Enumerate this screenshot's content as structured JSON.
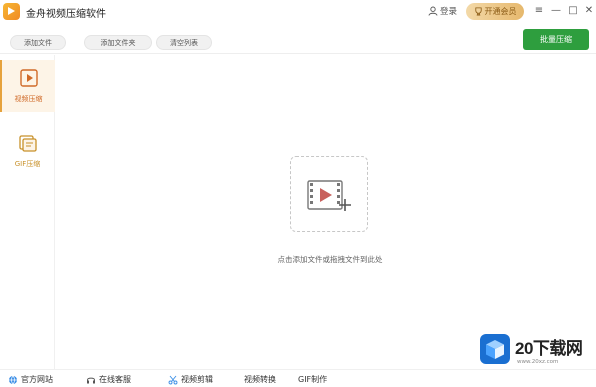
{
  "app": {
    "title": "金舟视频压缩软件"
  },
  "titlebar": {
    "login_label": "登录",
    "vip_label": "开通会员"
  },
  "toolbar": {
    "add_file_label": "添加文件",
    "add_folder_label": "添加文件夹",
    "clear_list_label": "清空列表",
    "batch_compress_label": "批量压缩"
  },
  "sidebar": {
    "items": [
      {
        "label": "视频压缩",
        "icon": "video-play-icon",
        "active": true
      },
      {
        "label": "GIF压缩",
        "icon": "gif-icon",
        "active": false
      }
    ]
  },
  "main": {
    "drop_hint": "点击添加文件或拖拽文件到此处"
  },
  "watermark": {
    "brand": "20下载网",
    "url": "www.20xz.com"
  },
  "footer": {
    "items": [
      {
        "label": "官方网站",
        "icon": "globe-icon"
      },
      {
        "label": "在线客服",
        "icon": "headset-icon"
      },
      {
        "label": "视频剪辑",
        "icon": "scissors-icon"
      },
      {
        "label": "视频转换",
        "icon": "convert-icon"
      },
      {
        "label": "GIF制作",
        "icon": "gif-icon"
      }
    ]
  },
  "colors": {
    "accent_green": "#2e9e3e",
    "accent_orange": "#e6a23c",
    "vip_gold": "#e6b86d",
    "play_red": "#c8605c"
  }
}
